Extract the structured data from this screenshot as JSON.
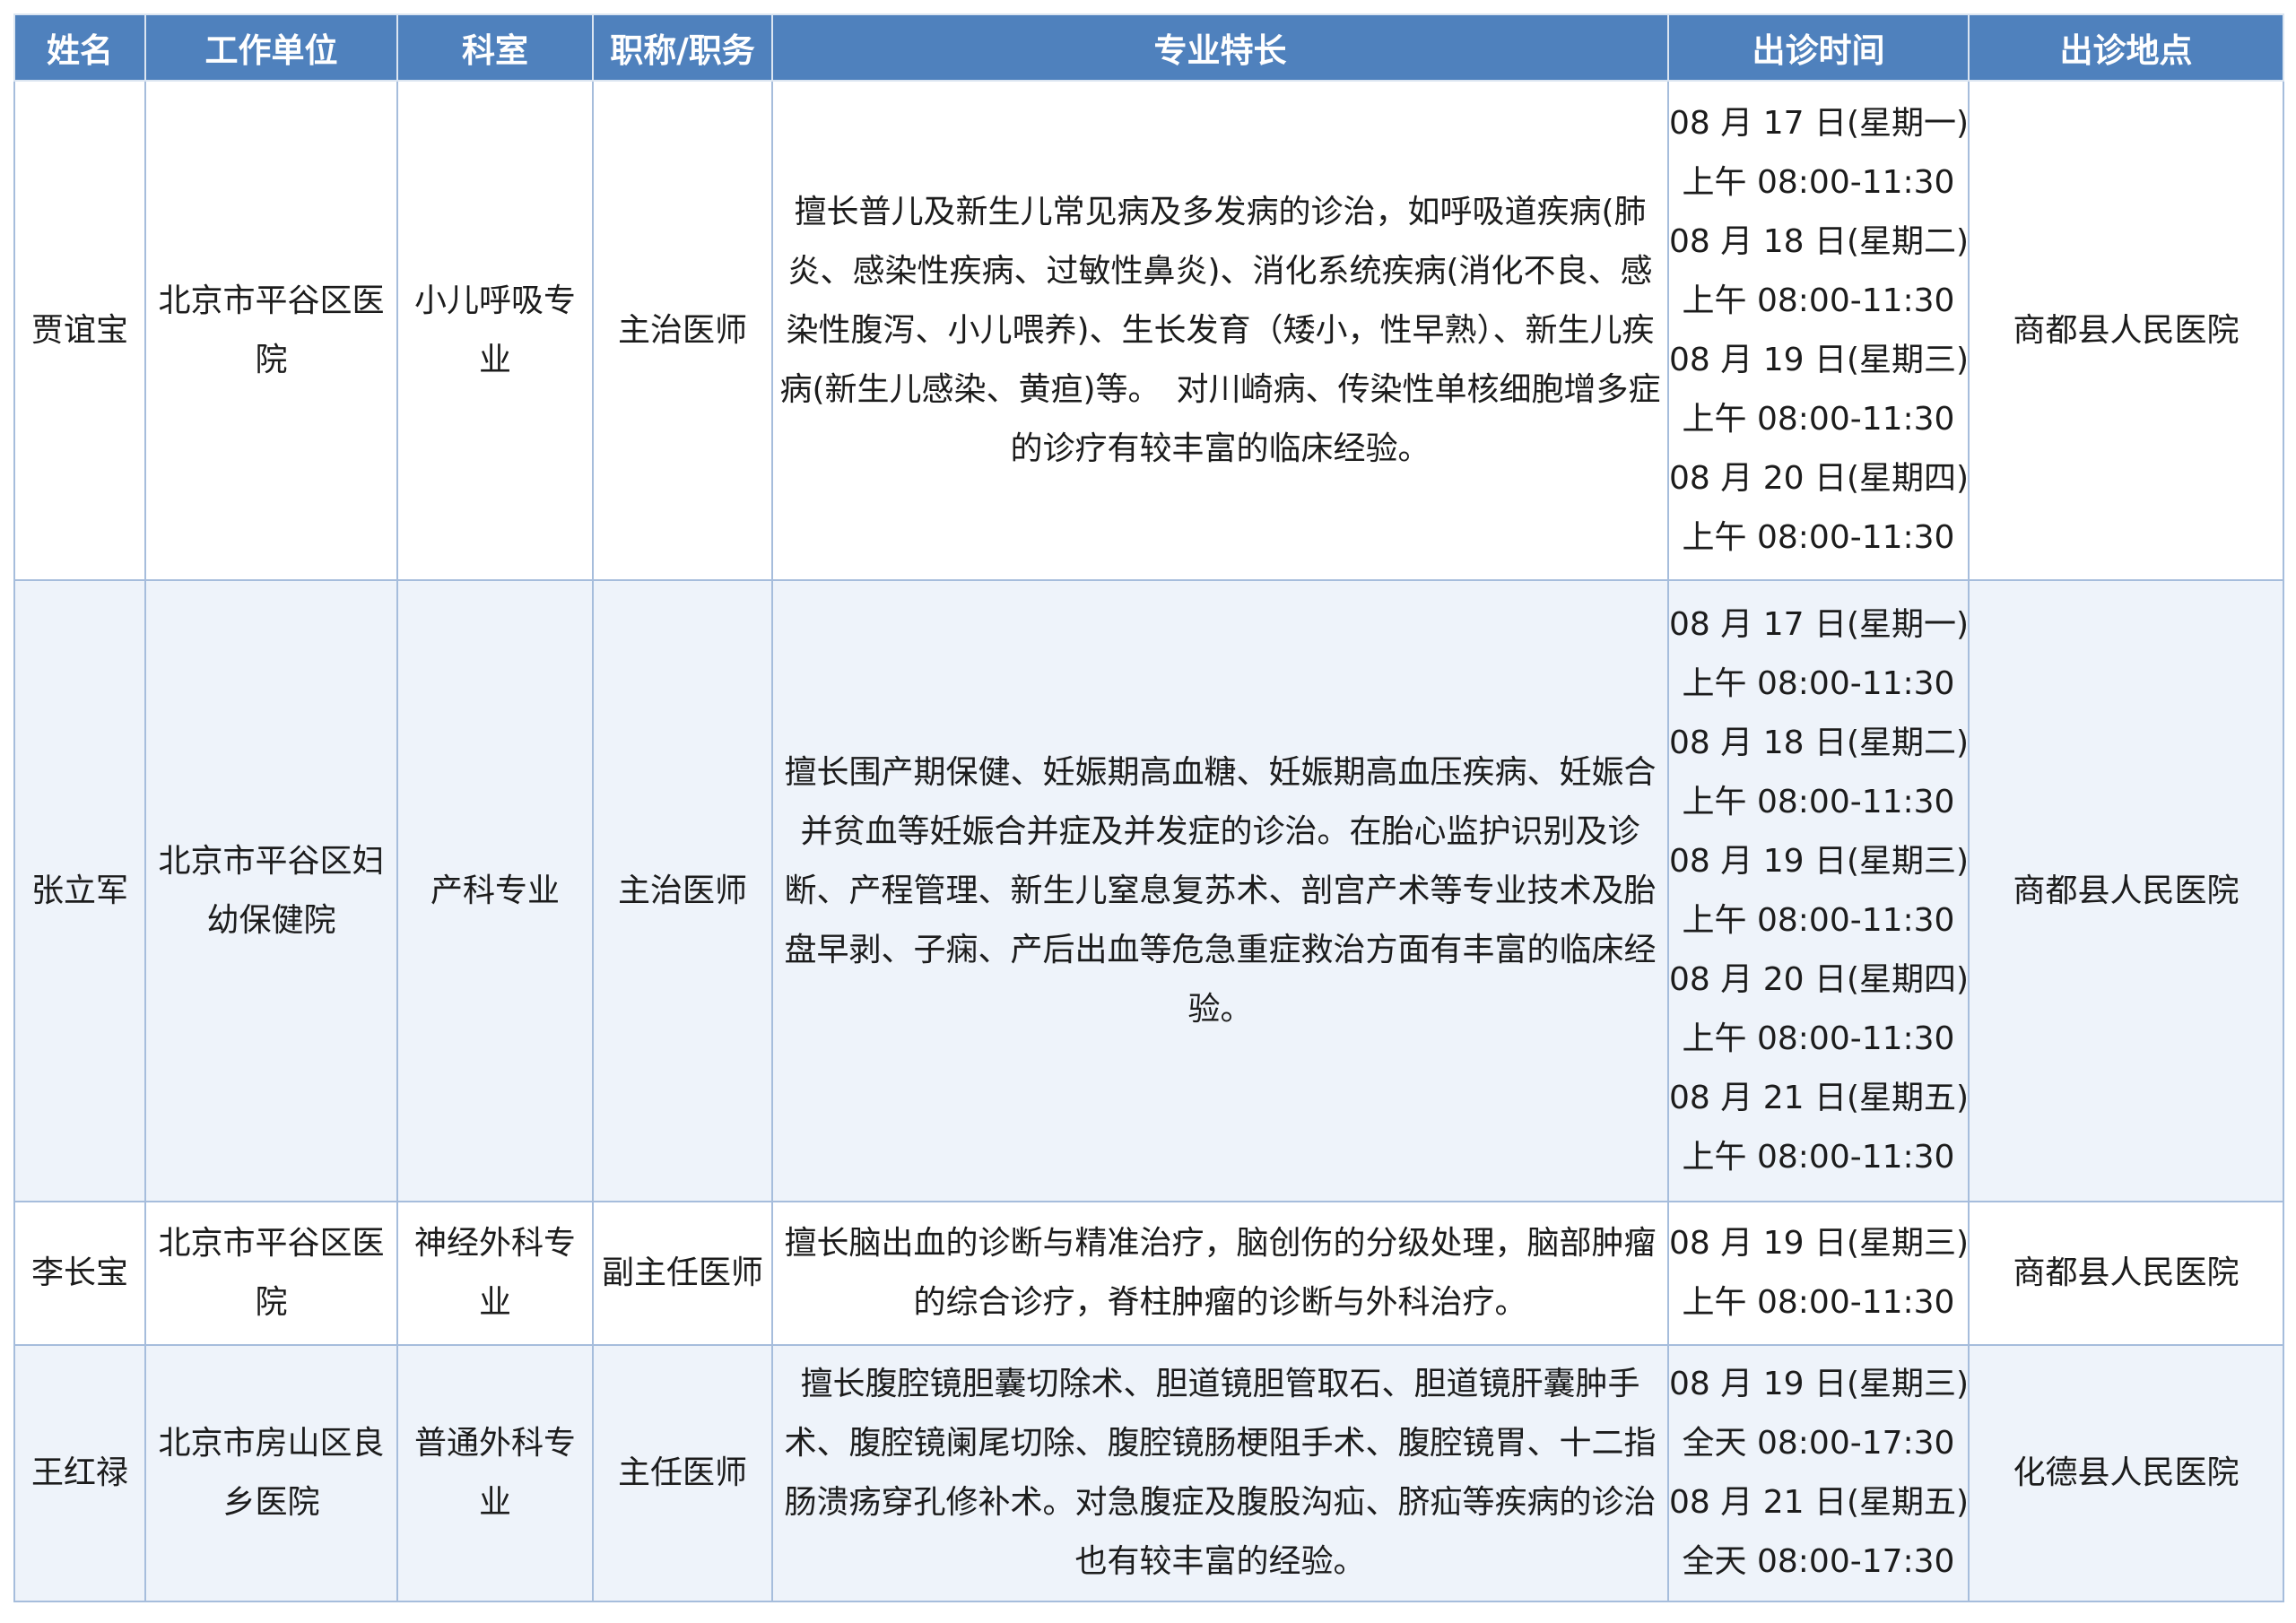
{
  "headers": {
    "name": "姓名",
    "unit": "工作单位",
    "dept": "科室",
    "title": "职称/职务",
    "specialty": "专业特长",
    "time": "出诊时间",
    "location": "出诊地点"
  },
  "rows": [
    {
      "name": "贾谊宝",
      "unit": "北京市平谷区医院",
      "dept": "小儿呼吸专业",
      "title": "主治医师",
      "specialty": "擅长普儿及新生儿常见病及多发病的诊治，如呼吸道疾病(肺炎、感染性疾病、过敏性鼻炎)、消化系统疾病(消化不良、感染性腹泻、小儿喂养)、生长发育（矮小，性早熟）、新生儿疾病(新生儿感染、黄疸)等。　对川崎病、传染性单核细胞增多症的诊疗有较丰富的临床经验。",
      "schedule": [
        "08 月 17 日(星期一)",
        "上午 08:00-11:30",
        "08 月 18 日(星期二)",
        "上午 08:00-11:30",
        "08 月 19 日(星期三)",
        "上午 08:00-11:30",
        "08 月 20 日(星期四)",
        "上午 08:00-11:30"
      ],
      "location": "商都县人民医院"
    },
    {
      "name": "张立军",
      "unit": "北京市平谷区妇幼保健院",
      "dept": "产科专业",
      "title": "主治医师",
      "specialty": "擅长围产期保健、妊娠期高血糖、妊娠期高血压疾病、妊娠合并贫血等妊娠合并症及并发症的诊治。在胎心监护识别及诊断、产程管理、新生儿窒息复苏术、剖宫产术等专业技术及胎盘早剥、子痫、产后出血等危急重症救治方面有丰富的临床经验。",
      "schedule": [
        "08 月 17 日(星期一)",
        "上午 08:00-11:30",
        "08 月 18 日(星期二)",
        "上午 08:00-11:30",
        "08 月 19 日(星期三)",
        "上午 08:00-11:30",
        "08 月 20 日(星期四)",
        "上午 08:00-11:30",
        "08 月 21 日(星期五)",
        "上午 08:00-11:30"
      ],
      "location": "商都县人民医院"
    },
    {
      "name": "李长宝",
      "unit": "北京市平谷区医院",
      "dept": "神经外科专业",
      "title": "副主任医师",
      "specialty": "擅长脑出血的诊断与精准治疗，脑创伤的分级处理，脑部肿瘤的综合诊疗，脊柱肿瘤的诊断与外科治疗。",
      "schedule": [
        "08 月 19 日(星期三)",
        "上午 08:00-11:30"
      ],
      "location": "商都县人民医院"
    },
    {
      "name": "王红禄",
      "unit": "北京市房山区良乡医院",
      "dept": "普通外科专业",
      "title": "主任医师",
      "specialty": "擅长腹腔镜胆囊切除术、胆道镜胆管取石、胆道镜肝囊肿手术、腹腔镜阑尾切除、腹腔镜肠梗阻手术、腹腔镜胃、十二指肠溃疡穿孔修补术。对急腹症及腹股沟疝、脐疝等疾病的诊治也有较丰富的经验。",
      "schedule": [
        "08 月 19 日(星期三)",
        "全天 08:00-17:30",
        "08 月 21 日(星期五)",
        "全天 08:00-17:30"
      ],
      "location": "化德县人民医院"
    }
  ]
}
